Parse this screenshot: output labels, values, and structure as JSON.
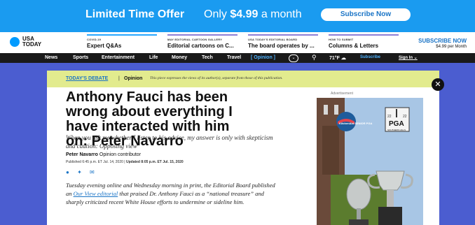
{
  "promo": {
    "title": "Limited Time Offer",
    "price_prefix": "Only ",
    "price": "$4.99",
    "price_suffix": " a month",
    "subscribe_label": "Subscribe Now"
  },
  "brand": {
    "logo_line1": "USA",
    "logo_line2": "TODAY"
  },
  "promo_items": [
    {
      "kicker": "COVID-19",
      "head": "Expert Q&As"
    },
    {
      "kicker": "MAY EDITORIAL CARTOON GALLERY",
      "head": "Editorial cartoons on C..."
    },
    {
      "kicker": "USA TODAY'S EDITORIAL BOARD",
      "head": "The board operates by ..."
    },
    {
      "kicker": "HOW TO SUBMIT",
      "head": "Columns & Letters"
    }
  ],
  "subscribe_now": {
    "label": "SUBSCRIBE NOW",
    "price": "$4.99 per Month"
  },
  "nav": {
    "items": [
      "News",
      "Sports",
      "Entertainment",
      "Life",
      "Money",
      "Tech",
      "Travel",
      "[ Opinion ]"
    ],
    "temp": "71°F",
    "subscribe": "Subscribe",
    "signin": "Sign In"
  },
  "debate": {
    "label": "TODAY'S DEBATE",
    "separator": "|",
    "opinion": "Opinion",
    "note": "This piece expresses the views of its author(s), separate from those of this publication."
  },
  "article": {
    "headline": "Anthony Fauci has been wrong about everything I have interacted with him on: Peter Navarro",
    "dek": "When you ask me whether I listen to his advice, my answer is only with skepticism and caution: Opposing view",
    "author": "Peter Navarro",
    "author_role": "Opinion contributor",
    "published": "Published 6:45 p.m. ET Jul. 14, 2020",
    "updated": "Updated 8:05 p.m. ET Jul. 15, 2020",
    "body_before": "Tuesday evening online and Wednesday morning in print, the Editorial Board published an ",
    "body_link": "Our View editorial",
    "body_after": " that praised Dr. Anthony Fauci as a “national treasure” and sharply criticized recent White House efforts to undermine or sideline him."
  },
  "ad": {
    "label": "Advertisement",
    "badge_left": "KitchenAid SENIOR PGA",
    "badge_year_left": "22",
    "badge_year_right": "22",
    "pga_text": "PGA",
    "pga_sub": "SOUTHERN HILLS"
  },
  "colors": {
    "promo_bg": "#1a9bf0",
    "page_bg": "#4b5dd0",
    "debate_bg": "#e2eb8e",
    "link": "#1a74c6"
  },
  "icons": [
    "chevron-down-icon",
    "search-icon",
    "weather-icon",
    "facebook-icon",
    "twitter-icon",
    "email-icon",
    "close-icon"
  ]
}
